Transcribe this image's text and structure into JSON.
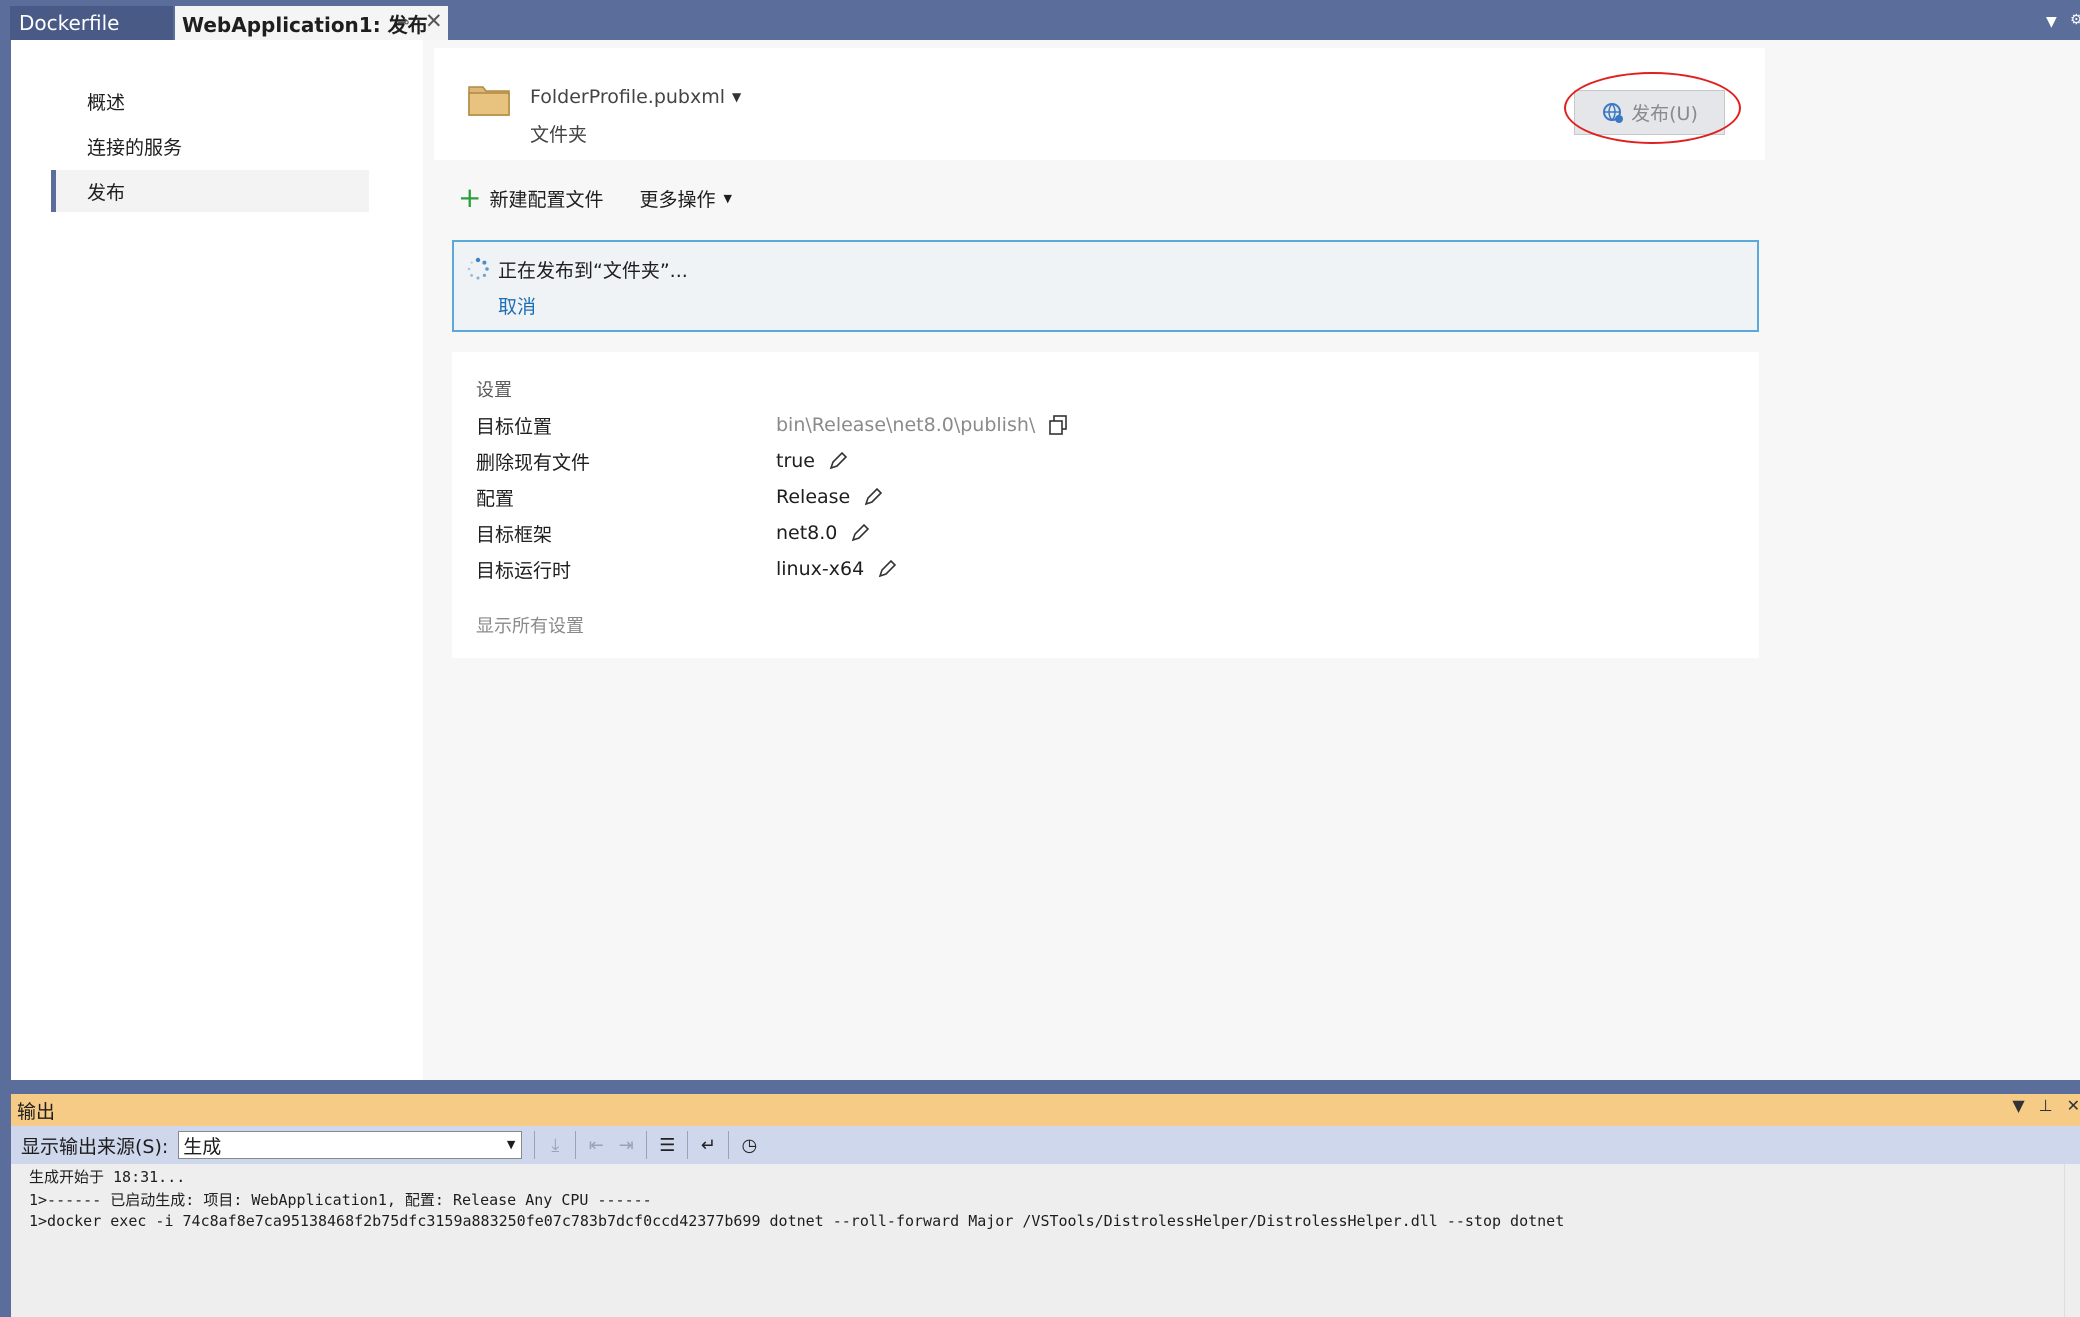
{
  "tabs": {
    "dockerfile": "Dockerfile",
    "publish": "WebApplication1: 发布"
  },
  "nav": {
    "overview": "概述",
    "connected_services": "连接的服务",
    "publish": "发布"
  },
  "profile": {
    "name": "FolderProfile.pubxml",
    "type": "文件夹",
    "publish_button": "发布(U)"
  },
  "actions": {
    "new_profile": "新建配置文件",
    "more": "更多操作"
  },
  "progress": {
    "text": "正在发布到“文件夹”...",
    "cancel": "取消"
  },
  "settings": {
    "title": "设置",
    "rows": [
      {
        "label": "目标位置",
        "value": "bin\\Release\\net8.0\\publish\\"
      },
      {
        "label": "删除现有文件",
        "value": "true"
      },
      {
        "label": "配置",
        "value": "Release"
      },
      {
        "label": "目标框架",
        "value": "net8.0"
      },
      {
        "label": "目标运行时",
        "value": "linux-x64"
      }
    ],
    "show_all": "显示所有设置"
  },
  "output": {
    "title": "输出",
    "source_label": "显示输出来源(S):",
    "source_value": "生成",
    "lines": [
      "生成开始于 18:31...",
      "1>------ 已启动生成: 项目: WebApplication1, 配置: Release Any CPU ------",
      "1>docker exec -i 74c8af8e7ca95138468f2b75dfc3159a883250fe07c783b7dcf0ccd42377b699 dotnet --roll-forward Major /VSTools/DistrolessHelper/DistrolessHelper.dll --stop dotnet"
    ]
  },
  "colors": {
    "accent": "#5b6d9a",
    "link": "#1f6fb5",
    "output_header": "#f5cb86",
    "callout": "#e0201e"
  }
}
